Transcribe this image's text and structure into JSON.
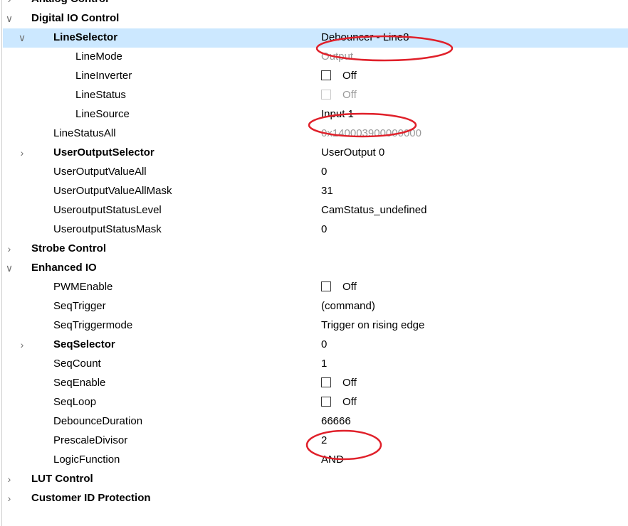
{
  "rows": [
    {
      "name": "Analog Control",
      "value": "",
      "bold": true,
      "expander": "collapsed",
      "level": 0
    },
    {
      "name": "Digital IO Control",
      "value": "",
      "bold": true,
      "expander": "expanded",
      "level": 0
    },
    {
      "name": "LineSelector",
      "value": "Debouncer - Line8",
      "bold": true,
      "expander": "expanded",
      "level": 1,
      "selected": true
    },
    {
      "name": "LineMode",
      "value": "Output",
      "level": 2,
      "disabled": true
    },
    {
      "name": "LineInverter",
      "value": "Off",
      "level": 2,
      "checkbox": true
    },
    {
      "name": "LineStatus",
      "value": "Off",
      "level": 2,
      "checkbox": true,
      "disabled": true
    },
    {
      "name": "LineSource",
      "value": "Input 1",
      "level": 2
    },
    {
      "name": "LineStatusAll",
      "value": "0x140003900000000",
      "level": 1,
      "disabled": true
    },
    {
      "name": "UserOutputSelector",
      "value": "UserOutput 0",
      "bold": true,
      "expander": "collapsed",
      "level": 1
    },
    {
      "name": "UserOutputValueAll",
      "value": "0",
      "level": 1
    },
    {
      "name": "UserOutputValueAllMask",
      "value": "31",
      "level": 1
    },
    {
      "name": "UseroutputStatusLevel",
      "value": "CamStatus_undefined",
      "level": 1
    },
    {
      "name": "UseroutputStatusMask",
      "value": "0",
      "level": 1
    },
    {
      "name": "Strobe Control",
      "value": "",
      "bold": true,
      "expander": "collapsed",
      "level": 0
    },
    {
      "name": "Enhanced IO",
      "value": "",
      "bold": true,
      "expander": "expanded",
      "level": 0
    },
    {
      "name": "PWMEnable",
      "value": "Off",
      "level": 1,
      "checkbox": true
    },
    {
      "name": "SeqTrigger",
      "value": "(command)",
      "level": 1
    },
    {
      "name": "SeqTriggermode",
      "value": "Trigger on rising edge",
      "level": 1
    },
    {
      "name": "SeqSelector",
      "value": "0",
      "bold": true,
      "expander": "collapsed",
      "level": 1
    },
    {
      "name": "SeqCount",
      "value": "1",
      "level": 1
    },
    {
      "name": "SeqEnable",
      "value": "Off",
      "level": 1,
      "checkbox": true
    },
    {
      "name": "SeqLoop",
      "value": "Off",
      "level": 1,
      "checkbox": true
    },
    {
      "name": "DebounceDuration",
      "value": "66666",
      "level": 1
    },
    {
      "name": "PrescaleDivisor",
      "value": "2",
      "level": 1
    },
    {
      "name": "LogicFunction",
      "value": "AND",
      "level": 1
    },
    {
      "name": "LUT Control",
      "value": "",
      "bold": true,
      "expander": "collapsed",
      "level": 0
    },
    {
      "name": "Customer ID Protection",
      "value": "",
      "bold": true,
      "expander": "collapsed",
      "level": 0
    }
  ],
  "highlight_rows": [
    "LineSelector",
    "LineSource",
    "DebounceDuration"
  ],
  "colors": {
    "selected_bg": "#cce8ff",
    "annotation_red": "#e0202a",
    "disabled_text": "#9a9a9a"
  },
  "icons": {
    "expanded": "chevron-down-icon",
    "collapsed": "chevron-right-icon"
  }
}
